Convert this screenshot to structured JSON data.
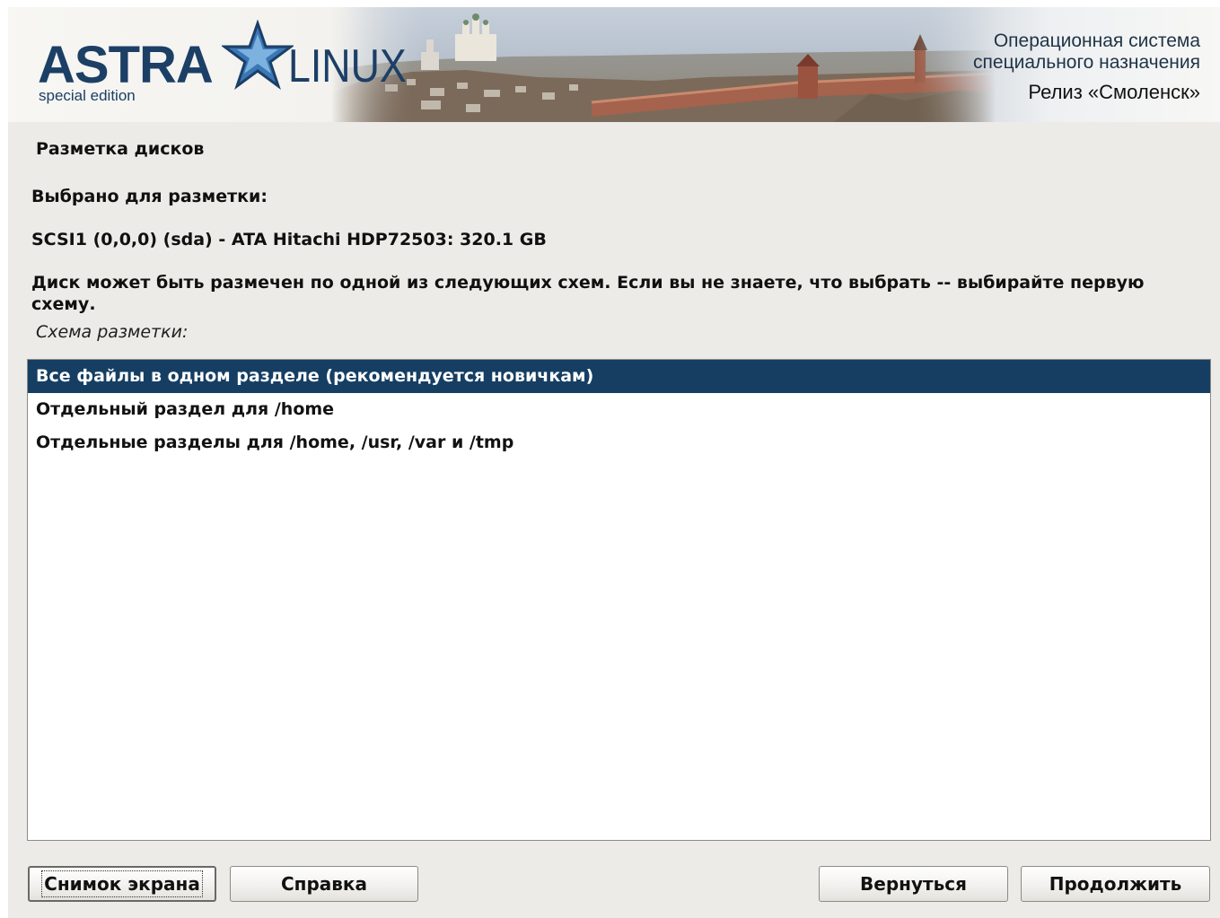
{
  "header": {
    "logo_astra": "ASTRA",
    "logo_linux": "LINUX",
    "logo_edition": "special edition",
    "tagline_line1": "Операционная система",
    "tagline_line2": "специального назначения",
    "release": "Релиз «Смоленск»",
    "logo_icon": "star-icon",
    "brand_color": "#1c3f66"
  },
  "page": {
    "title": "Разметка дисков",
    "selected_label": "Выбрано для разметки:",
    "disk": "SCSI1 (0,0,0) (sda) - ATA Hitachi HDP72503: 320.1 GB",
    "hint": "Диск может быть размечен по одной из следующих схем. Если вы не знаете, что выбрать -- выбирайте первую схему.",
    "list_label": "Схема разметки:"
  },
  "scheme_list": {
    "selected_index": 0,
    "selection_color": "#163e63",
    "items": [
      "Все файлы в одном разделе (рекомендуется новичкам)",
      "Отдельный раздел для /home",
      "Отдельные разделы для /home, /usr, /var и /tmp"
    ]
  },
  "buttons": {
    "screenshot": "Снимок экрана",
    "help": "Справка",
    "back": "Вернуться",
    "continue": "Продолжить"
  }
}
